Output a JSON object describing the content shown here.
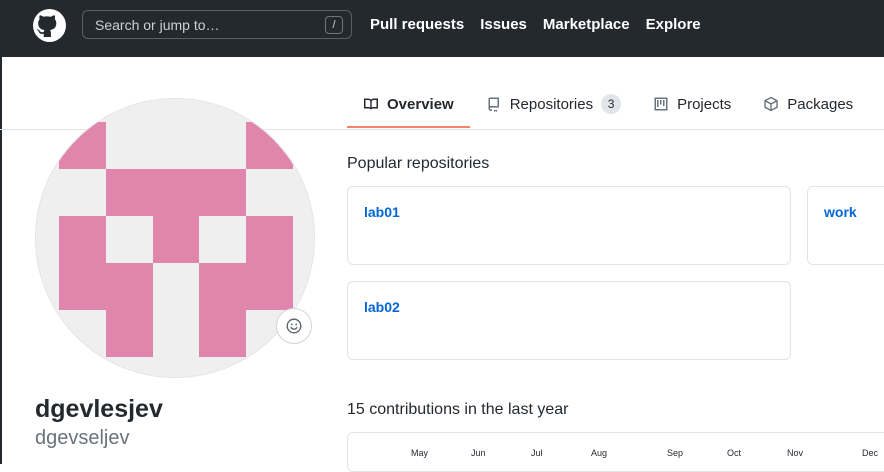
{
  "header": {
    "search_placeholder": "Search or jump to…",
    "slash_key": "/",
    "nav": [
      "Pull requests",
      "Issues",
      "Marketplace",
      "Explore"
    ]
  },
  "tabs": {
    "overview": "Overview",
    "repositories": "Repositories",
    "repositories_count": "3",
    "projects": "Projects",
    "packages": "Packages"
  },
  "profile": {
    "name": "dgevlesjev",
    "username": "dgevseljev",
    "avatar_color": "#e086ac",
    "avatar_bg": "#efefef"
  },
  "popular": {
    "title": "Popular repositories",
    "repos": [
      "lab01",
      "work",
      "lab02"
    ]
  },
  "contributions": {
    "title": "15 contributions in the last year",
    "months": [
      "May",
      "Jun",
      "Jul",
      "Aug",
      "Sep",
      "Oct",
      "Nov",
      "Dec"
    ]
  },
  "colors": {
    "header_bg": "#24292e",
    "link": "#0366d6",
    "tab_underline": "#f9826c"
  }
}
